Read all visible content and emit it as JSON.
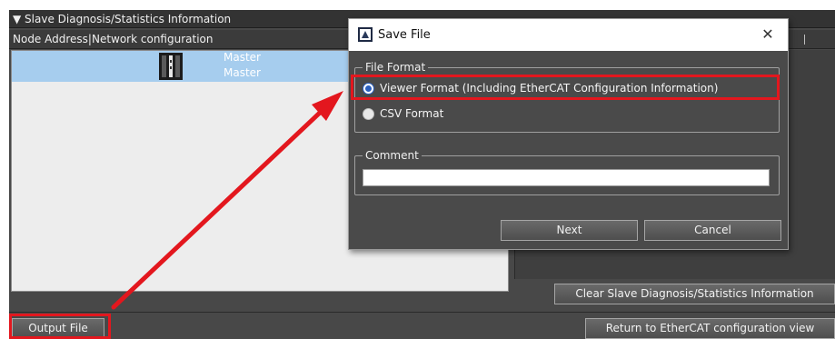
{
  "panel": {
    "title": "▼ Slave Diagnosis/Statistics Information",
    "column_header": "Node Address|Network configuration",
    "tree": {
      "node_name": "Master",
      "node_model": "Master"
    },
    "clear_button": "Clear Slave Diagnosis/Statistics Information",
    "output_button": "Output File",
    "return_button": "Return to EtherCAT configuration view"
  },
  "dialog": {
    "title": "Save File",
    "close_glyph": "✕",
    "file_format_label": "File Format",
    "options": [
      {
        "label": "Viewer Format (Including EtherCAT Configuration Information)",
        "selected": true
      },
      {
        "label": "CSV Format",
        "selected": false
      }
    ],
    "comment_label": "Comment",
    "comment_value": "",
    "next_button": "Next",
    "cancel_button": "Cancel"
  },
  "annotations": {
    "highlight_color": "#e3171e"
  },
  "icons": {
    "dialog_icon": "app-window-icon",
    "device_icon": "controller-device-icon"
  }
}
